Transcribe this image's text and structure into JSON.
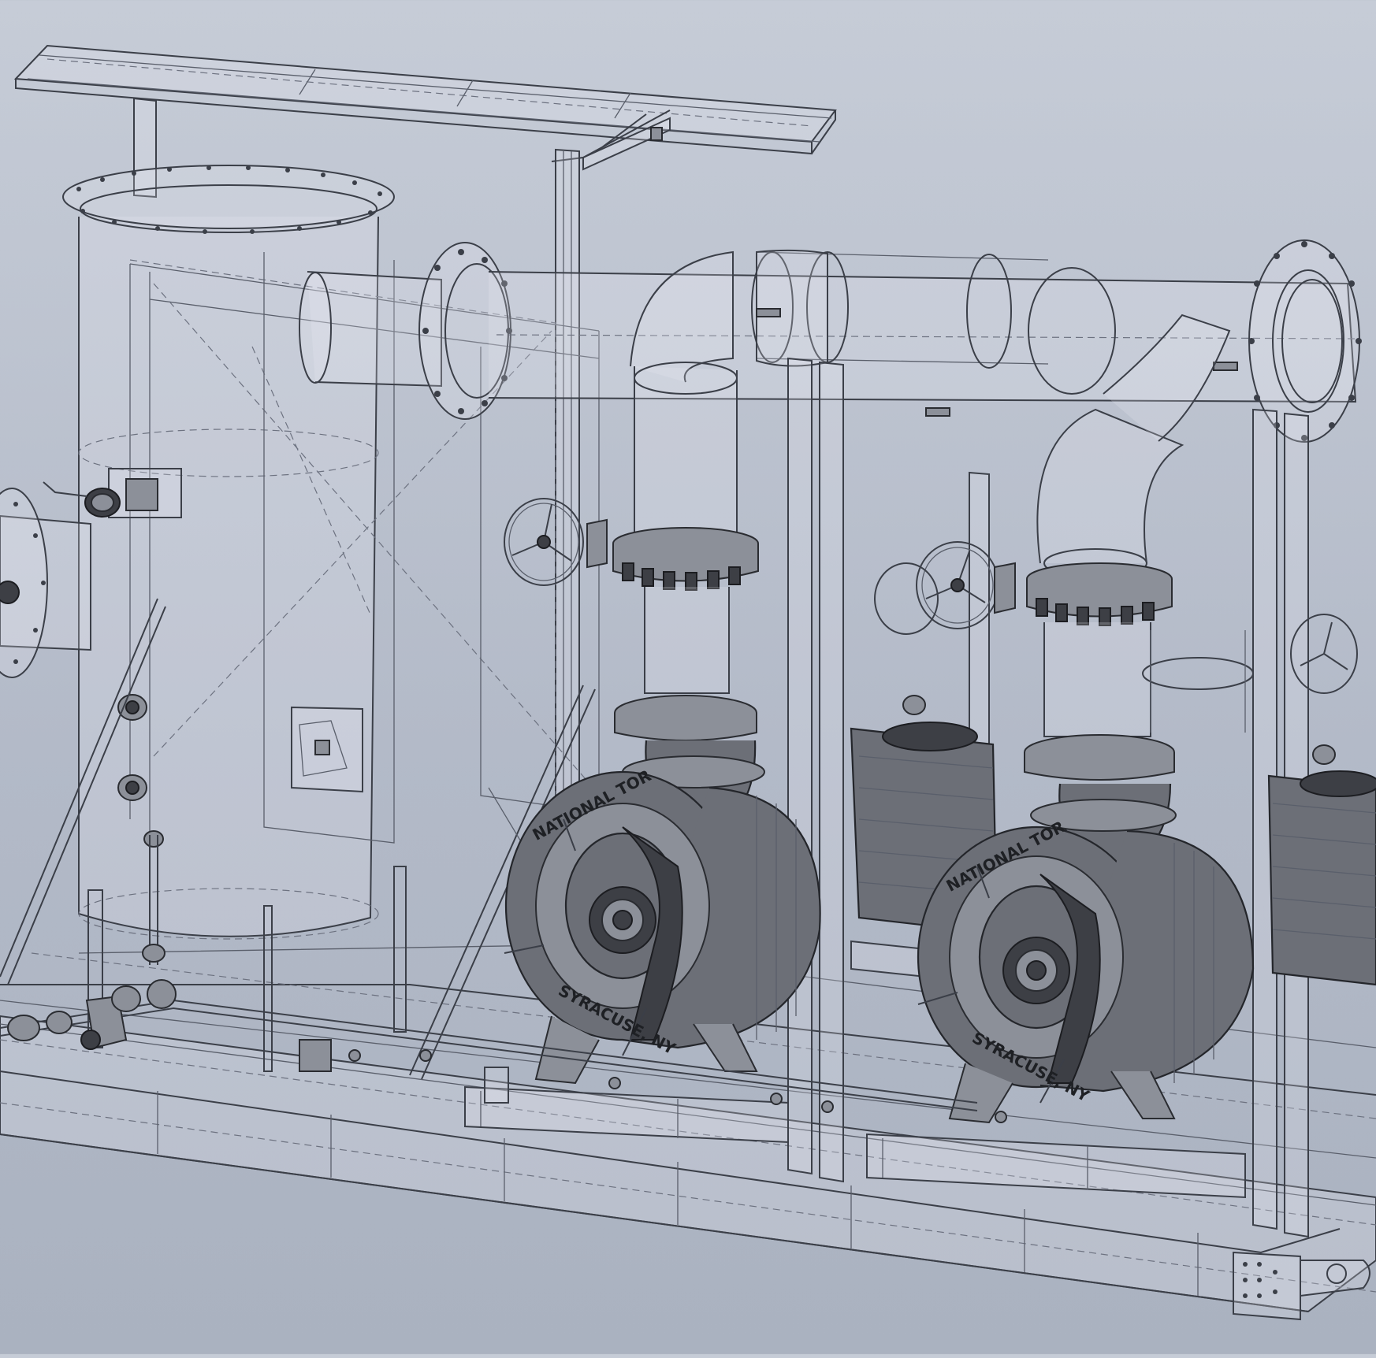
{
  "scene": {
    "background_top": "#c6ccd7",
    "background_bottom": "#aab2c0",
    "line_color": "#3b3f48",
    "solid_color": "#6c6f77"
  },
  "pumps": [
    {
      "casting_text_top": "NATIONAL TOR",
      "casting_text_bottom": "SYRACUSE, NY"
    },
    {
      "casting_text_top": "NATIONAL TOR",
      "casting_text_bottom": "SYRACUSE, NY"
    }
  ]
}
